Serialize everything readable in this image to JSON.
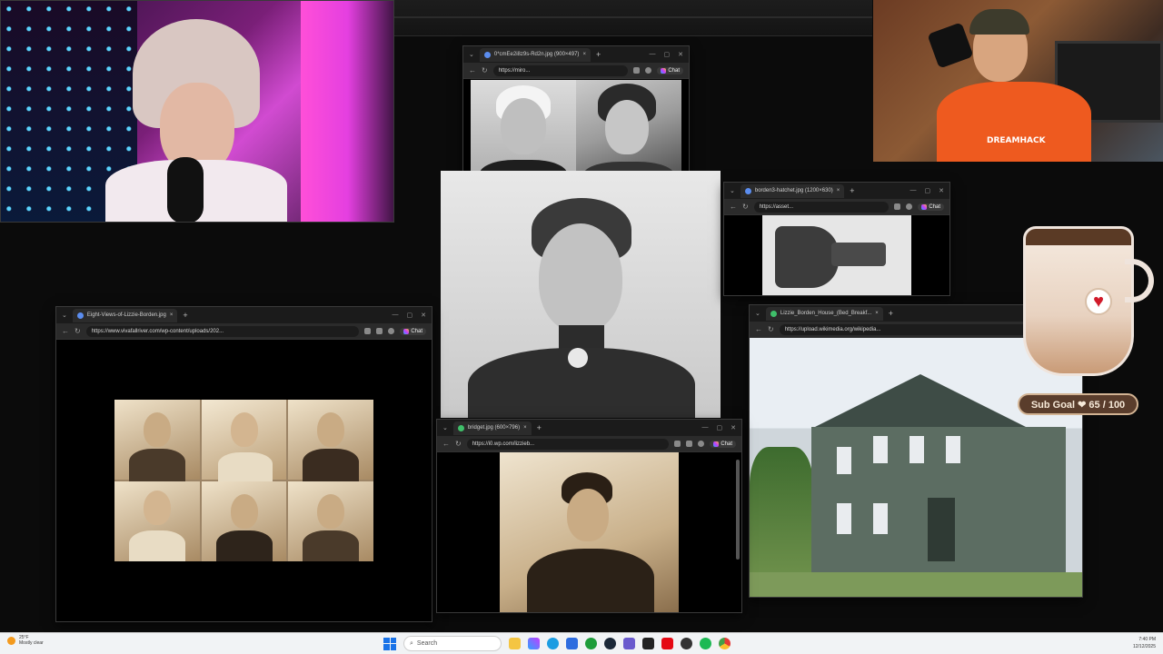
{
  "topbar": {},
  "windows": {
    "miro": {
      "tab": "0*cmEe2i8z9s-Rd2n.jpg (900×497)",
      "url": "https://miro...",
      "chat": "Chat"
    },
    "hatchet": {
      "tab": "borden3-hatchet.jpg (1200×630)",
      "url": "https://asset...",
      "chat": "Chat"
    },
    "eight": {
      "tab": "Eight-Views-of-Lizzie-Borden.jpg",
      "url": "https://www.vivafallriver.com/wp-content/uploads/202...",
      "chat": "Chat"
    },
    "house": {
      "tab": "Lizzie_Borden_House_(Bed_Breakf...",
      "url": "https://upload.wikimedia.org/wikipedia..."
    },
    "bridget": {
      "tab": "bridget.jpg (600×796)",
      "url": "https://i0.wp.com/lizzieb...",
      "chat": "Chat"
    }
  },
  "widget": {
    "subgoal": "Sub Goal ❤ 65 / 100",
    "current": 65,
    "target": 100
  },
  "taskbar": {
    "weather_temp": "25°F",
    "weather_desc": "Mostly clear",
    "search_placeholder": "Search",
    "time": "7:40 PM",
    "date": "12/12/2025"
  },
  "colors": {
    "accent": "#1a73e8",
    "heart": "#d11a2a",
    "mug_brown": "#5a3d2c"
  },
  "icons": [
    "windows-start-icon",
    "search-icon",
    "file-explorer-icon",
    "edge-icon",
    "store-icon",
    "steam-icon",
    "spotify-icon",
    "netflix-icon"
  ]
}
